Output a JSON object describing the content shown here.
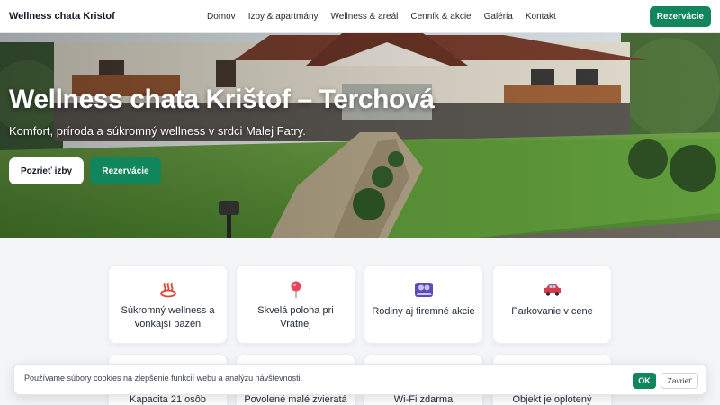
{
  "nav": {
    "brand": "Wellness chata Kristof",
    "items": [
      "Domov",
      "Izby & apartmány",
      "Wellness & areál",
      "Cenník & akcie",
      "Galéria",
      "Kontakt"
    ],
    "cta": "Rezervácie"
  },
  "hero": {
    "title": "Wellness chata Krištof – Terchová",
    "subtitle": "Komfort, príroda a súkromný wellness v srdci Malej Fatry.",
    "primary_button": "Pozrieť izby",
    "secondary_button": "Rezervácie"
  },
  "features": [
    {
      "icon": "hot-springs-icon",
      "line1": "Súkromný wellness a",
      "line2": "vonkajší bazén"
    },
    {
      "icon": "location-pin-icon",
      "line1": "Skvelá poloha pri",
      "line2": "Vrátnej"
    },
    {
      "icon": "people-icon",
      "line1": "Rodiny aj firemné akcie",
      "line2": ""
    },
    {
      "icon": "car-icon",
      "line1": "Parkovanie v cene",
      "line2": ""
    }
  ],
  "features_row2": [
    {
      "label": "Kapacita 21 osôb"
    },
    {
      "label": "Povolené malé zvieratá"
    },
    {
      "label": "Wi-Fi zdarma"
    },
    {
      "label": "Objekt je oplotený"
    }
  ],
  "cookie": {
    "text": "Používame súbory cookies na zlepšenie funkcií webu a analýzu návštevnosti.",
    "accept": "OK",
    "close": "Zavrieť"
  },
  "colors": {
    "accent": "#11855b",
    "nav_bg": "#ffffff",
    "page_bg": "#f4f5f7"
  }
}
